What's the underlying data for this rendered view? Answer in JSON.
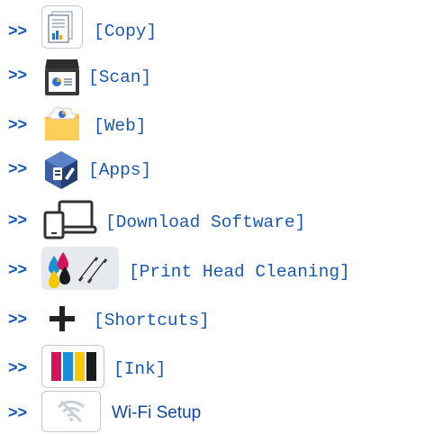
{
  "bullet_symbol": ">>",
  "items": [
    {
      "label": "[Copy]",
      "icon": "copy-icon"
    },
    {
      "label": "[Scan]",
      "icon": "scan-icon"
    },
    {
      "label": "[Web]",
      "icon": "web-icon"
    },
    {
      "label": "[Apps]",
      "icon": "apps-icon"
    },
    {
      "label": "[Download Software]",
      "icon": "download-software-icon"
    },
    {
      "label": "[Print Head Cleaning]",
      "icon": "print-head-cleaning-icon"
    },
    {
      "label": "[Shortcuts]",
      "icon": "shortcuts-icon"
    },
    {
      "label": "[Ink]",
      "icon": "ink-icon"
    },
    {
      "label": "Wi-Fi Setup",
      "icon": "wifi-off-icon"
    }
  ],
  "colors": {
    "link": "#1a58b3",
    "ink_cyan": "#1a8fd6",
    "ink_magenta": "#d4145a",
    "ink_yellow": "#f7c800",
    "ink_black": "#1a1a1a",
    "folder_yellow": "#f9c23c",
    "apps_blue": "#2e4f8f"
  }
}
